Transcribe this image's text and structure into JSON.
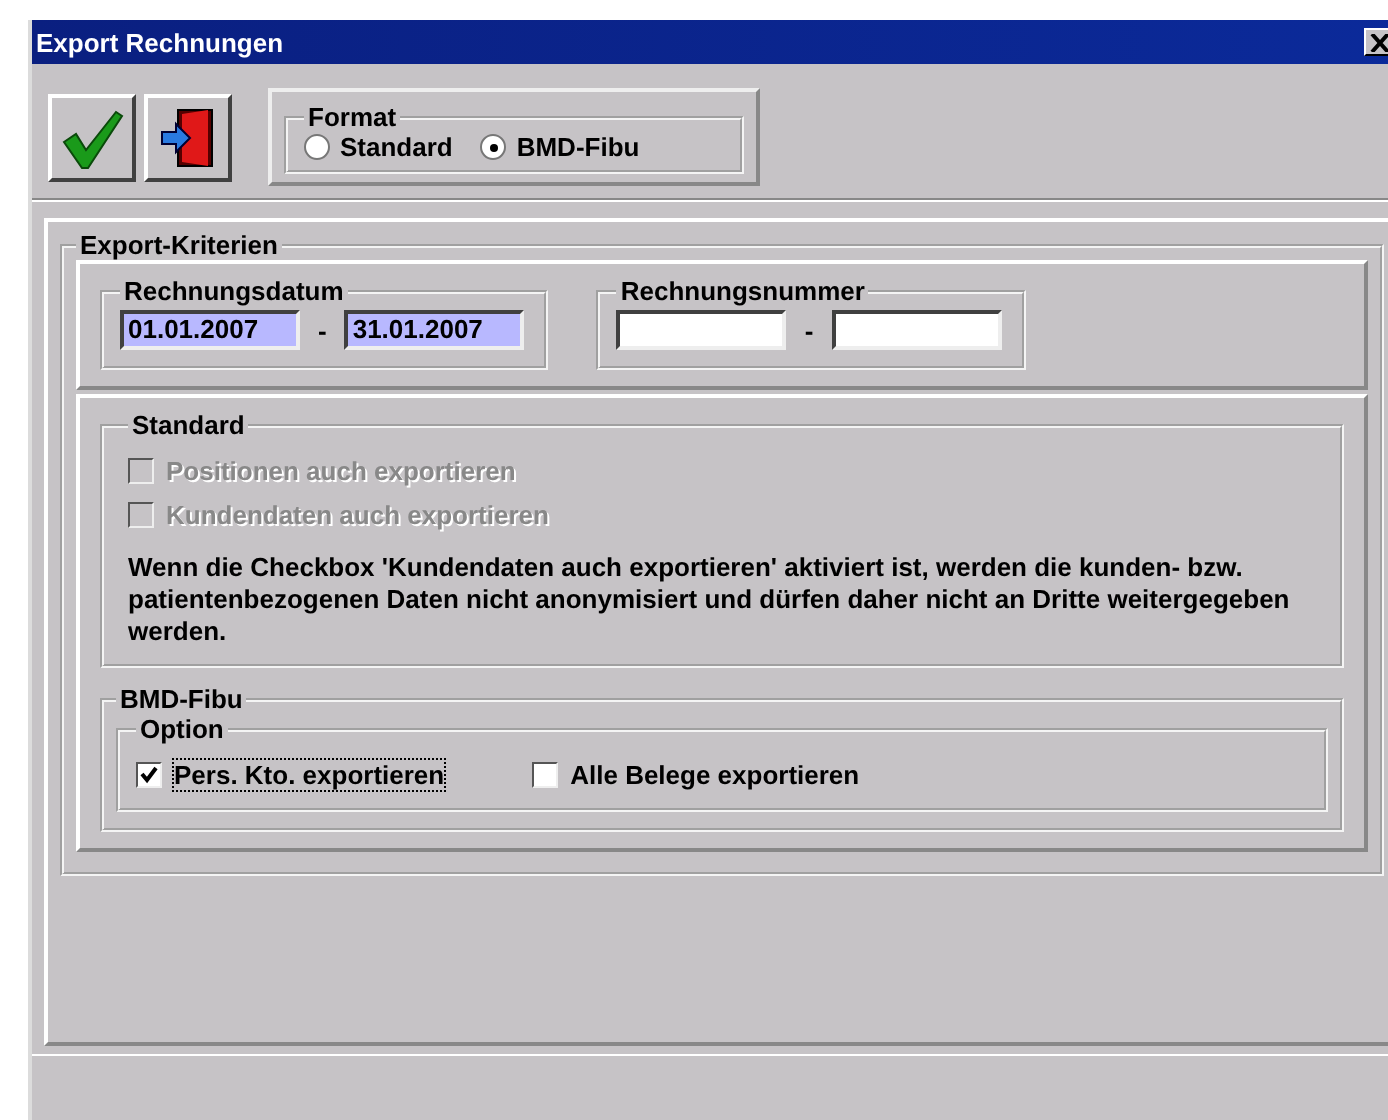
{
  "window": {
    "title": "Export Rechnungen"
  },
  "format": {
    "title": "Format",
    "options": [
      {
        "label": "Standard",
        "selected": false
      },
      {
        "label": "BMD-Fibu",
        "selected": true
      }
    ]
  },
  "criteria": {
    "title": "Export-Kriterien",
    "date": {
      "title": "Rechnungsdatum",
      "from": "01.01.2007",
      "separator": "-",
      "to": "31.01.2007"
    },
    "number": {
      "title": "Rechnungsnummer",
      "separator": "-"
    }
  },
  "standard": {
    "title": "Standard",
    "checkboxes": [
      {
        "label": "Positionen auch exportieren",
        "checked": false,
        "disabled": true
      },
      {
        "label": "Kundendaten auch exportieren",
        "checked": false,
        "disabled": true
      }
    ],
    "note": "Wenn die Checkbox 'Kundendaten auch exportieren' aktiviert ist, werden die kunden- bzw. patientenbezogenen Daten nicht anonymisiert und dürfen daher nicht an Dritte weitergegeben werden."
  },
  "bmd": {
    "title": "BMD-Fibu",
    "option_title": "Option",
    "checkboxes": [
      {
        "label": "Pers. Kto. exportieren",
        "checked": true,
        "focused": true
      },
      {
        "label": "Alle Belege exportieren",
        "checked": false,
        "focused": false
      }
    ]
  }
}
